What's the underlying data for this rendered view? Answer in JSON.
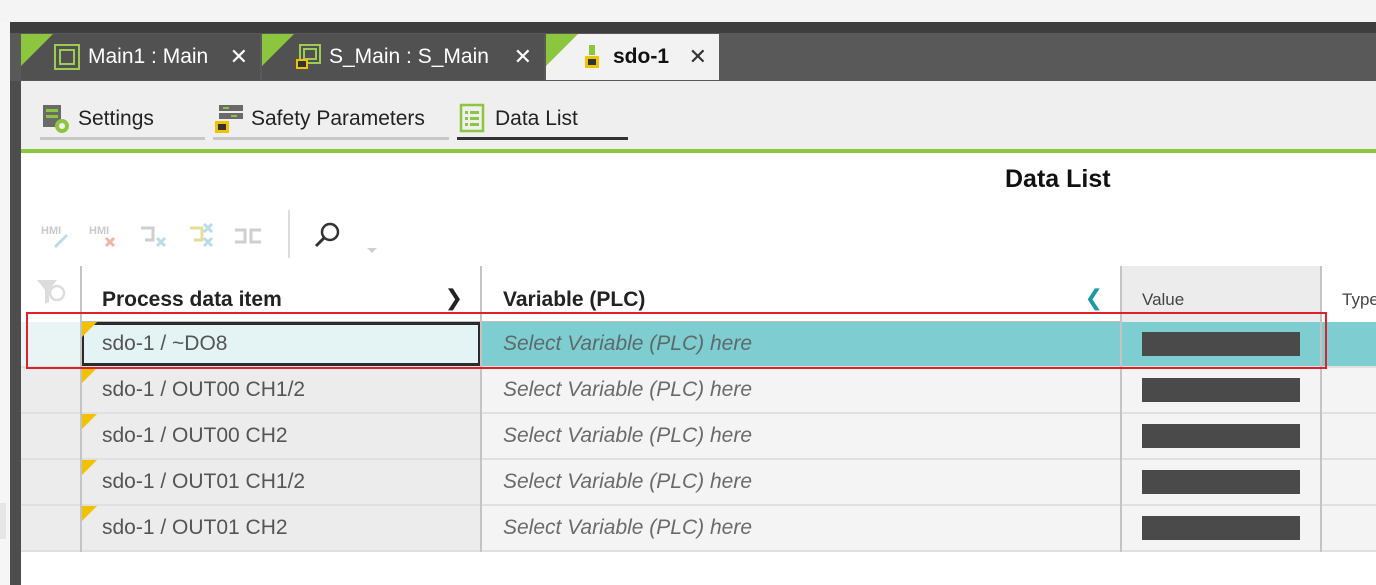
{
  "tabs": [
    {
      "label": "Main1 : Main",
      "icon": "program-icon",
      "active": false
    },
    {
      "label": "S_Main : S_Main",
      "icon": "safety-program-icon",
      "active": false
    },
    {
      "label": "sdo-1",
      "icon": "safety-device-icon",
      "active": true
    }
  ],
  "close_glyph": "✕",
  "subtabs": [
    {
      "label": "Settings",
      "icon": "settings-icon"
    },
    {
      "label": "Safety Parameters",
      "icon": "safety-parameters-icon"
    },
    {
      "label": "Data List",
      "icon": "data-list-icon",
      "active": true
    }
  ],
  "page_title": "Data List",
  "toolbar": {
    "tools": [
      "HMI",
      "HMI",
      "",
      "",
      ""
    ],
    "tool_icons": [
      "hmi-edit-icon",
      "hmi-delete-icon",
      "assign-icon",
      "unassign-icon",
      "swap-icon",
      "search-icon"
    ]
  },
  "grid": {
    "headers": {
      "item": "Process data item",
      "item_arrow": "❯",
      "variable": "Variable (PLC)",
      "variable_arrow": "❮",
      "value": "Value",
      "type": "Type"
    },
    "rows": [
      {
        "item": "sdo-1 / ~DO8",
        "variable": "Select Variable (PLC) here",
        "selected": true
      },
      {
        "item": "sdo-1 / OUT00 CH1/2",
        "variable": "Select Variable (PLC) here",
        "selected": false
      },
      {
        "item": "sdo-1 / OUT00 CH2",
        "variable": "Select Variable (PLC) here",
        "selected": false
      },
      {
        "item": "sdo-1 / OUT01 CH1/2",
        "variable": "Select Variable (PLC) here",
        "selected": false
      },
      {
        "item": "sdo-1 / OUT01 CH2",
        "variable": "Select Variable (PLC) here",
        "selected": false
      }
    ]
  },
  "colors": {
    "accent_green": "#8cc63f",
    "selection_teal": "#7ecdd1",
    "highlight_red": "#e0202a",
    "marker_yellow": "#f2c200"
  }
}
